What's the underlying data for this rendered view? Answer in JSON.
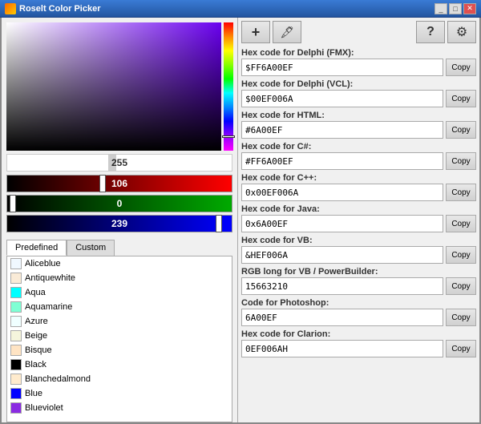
{
  "window": {
    "title": "Roselt Color Picker"
  },
  "picker": {
    "color_value": "#6A00EF",
    "selected_color_rgb": {
      "r": 106,
      "g": 0,
      "b": 239
    },
    "white_bar_value": "255",
    "red_value": "106",
    "green_value": "0",
    "blue_value": "239"
  },
  "tabs": {
    "predefined_label": "Predefined",
    "custom_label": "Custom"
  },
  "colors": [
    {
      "name": "Aliceblue",
      "hex": "#F0F8FF"
    },
    {
      "name": "Antiquewhite",
      "hex": "#FAEBD7"
    },
    {
      "name": "Aqua",
      "hex": "#00FFFF"
    },
    {
      "name": "Aquamarine",
      "hex": "#7FFFD4"
    },
    {
      "name": "Azure",
      "hex": "#F0FFFF"
    },
    {
      "name": "Beige",
      "hex": "#F5F5DC"
    },
    {
      "name": "Bisque",
      "hex": "#FFE4C4"
    },
    {
      "name": "Black",
      "hex": "#000000"
    },
    {
      "name": "Blanchedalmond",
      "hex": "#FFEBCD"
    },
    {
      "name": "Blue",
      "hex": "#0000FF"
    },
    {
      "name": "Blueviolet",
      "hex": "#8A2BE2"
    }
  ],
  "hex_codes": [
    {
      "label": "Hex code for Delphi (FMX):",
      "value": "$FF6A00EF"
    },
    {
      "label": "Hex code for Delphi (VCL):",
      "value": "$00EF006A"
    },
    {
      "label": "Hex code for HTML:",
      "value": "#6A00EF"
    },
    {
      "label": "Hex code for C#:",
      "value": "#FF6A00EF"
    },
    {
      "label": "Hex code for C++:",
      "value": "0x00EF006A"
    },
    {
      "label": "Hex code for Java:",
      "value": "0x6A00EF"
    },
    {
      "label": "Hex code for VB:",
      "value": "&HEF006A"
    },
    {
      "label": "RGB long for VB / PowerBuilder:",
      "value": "15663210"
    },
    {
      "label": "Code for Photoshop:",
      "value": "6A00EF"
    },
    {
      "label": "Hex code for Clarion:",
      "value": "0EF006AH"
    }
  ],
  "buttons": {
    "plus_icon": "+",
    "eyedropper_icon": "✒",
    "question_icon": "?",
    "settings_icon": "⚙",
    "copy_label": "Copy"
  }
}
